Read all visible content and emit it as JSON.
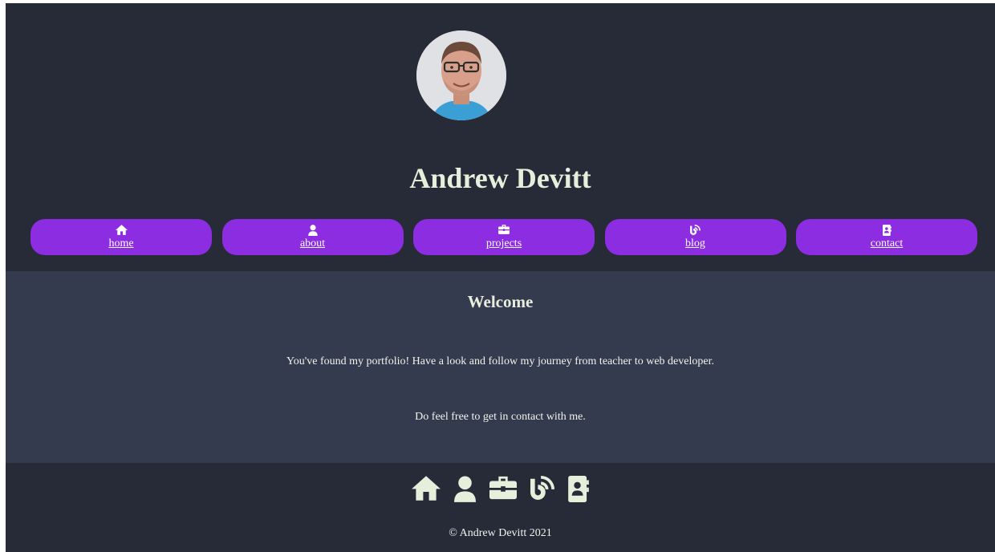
{
  "profile": {
    "name": "Andrew Devitt",
    "photo": "profile-photo"
  },
  "nav": {
    "items": [
      {
        "label": "home",
        "icon": "home-icon"
      },
      {
        "label": "about",
        "icon": "user-icon"
      },
      {
        "label": "projects",
        "icon": "briefcase-icon"
      },
      {
        "label": "blog",
        "icon": "blog-icon"
      },
      {
        "label": "contact",
        "icon": "contact-book-icon"
      }
    ]
  },
  "main": {
    "heading": "Welcome",
    "paragraphs": [
      "You've found my portfolio! Have a look and follow my journey from teacher to web developer.",
      "Do feel free to get in contact with me."
    ]
  },
  "footer": {
    "icons": [
      "home-icon",
      "user-icon",
      "briefcase-icon",
      "blog-icon",
      "contact-book-icon"
    ],
    "copyright": "© Andrew Devitt 2021"
  },
  "colors": {
    "header_bg": "#262b37",
    "main_bg": "#353b4e",
    "nav_button": "#8d2de2",
    "heading_text": "#e7eedb",
    "body_text": "#f1f3ec"
  }
}
